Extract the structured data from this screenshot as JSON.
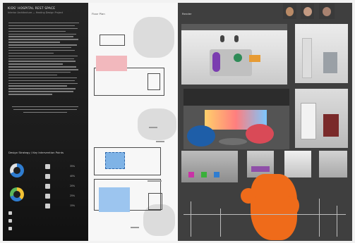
{
  "board": {
    "title": "KIDS' HOSPITAL REST SPACE",
    "subtitle": "Interior Architecture — Healing Design Project",
    "section_label": "Design Strategy / Key Intervention Points",
    "panel2_label": "Floor Plan",
    "panel3_label": "Render"
  },
  "participants": [
    {
      "name": "participant-1",
      "color": "#b98a66"
    },
    {
      "name": "participant-2",
      "color": "#c39a82"
    },
    {
      "name": "participant-3",
      "color": "#a88270"
    }
  ],
  "stats": [
    "35%",
    "40%",
    "20%",
    "25%",
    "15%"
  ],
  "colors": {
    "accent_orange": "#ef6b1a",
    "plan_pink": "#f2b8bd",
    "plan_blue": "#7fb3e6",
    "donut_blue": "#2f7dd1",
    "donut_yellow": "#f2c235"
  }
}
